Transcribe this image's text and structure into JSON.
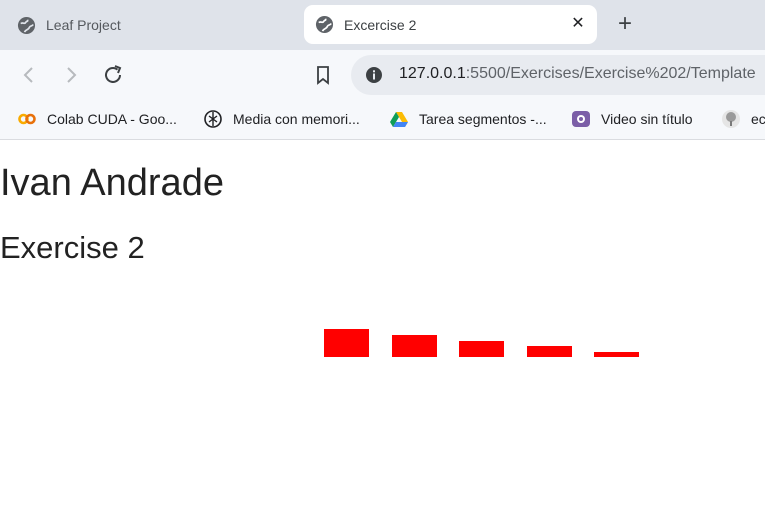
{
  "tabs": [
    {
      "title": "Leaf Project",
      "active": false
    },
    {
      "title": "Excercise 2",
      "active": true
    }
  ],
  "tab_close_glyph": "✕",
  "new_tab_glyph": "+",
  "address": {
    "host": "127.0.0.1",
    "rest": ":5500/Exercises/Exercise%202/Template"
  },
  "bookmarks": [
    {
      "label": "Colab CUDA - Goo...",
      "icon": "colab-icon"
    },
    {
      "label": "Media con memori...",
      "icon": "openai-icon"
    },
    {
      "label": "Tarea segmentos -...",
      "icon": "google-drive-icon"
    },
    {
      "label": "Video sin título",
      "icon": "video-icon"
    },
    {
      "label": "ec",
      "icon": "tree-icon"
    }
  ],
  "page": {
    "name": "Ivan Andrade",
    "subtitle": "Exercise 2"
  },
  "chart_data": {
    "type": "bar",
    "bar_color": "#ff0000",
    "values": [
      28,
      22,
      16,
      11,
      5
    ],
    "ylim": [
      0,
      28
    ]
  },
  "colors": {
    "tabstrip": "#dfe3ea",
    "toolbar": "#f6f8fb",
    "omnibox": "#e8ebf0"
  }
}
